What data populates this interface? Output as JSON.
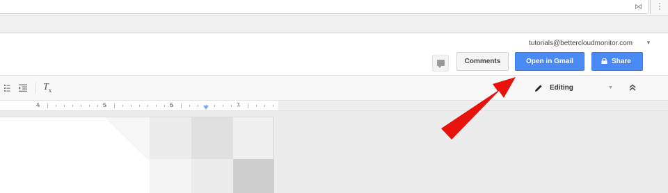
{
  "browser": {
    "extension_icon": "⋈",
    "menu_icon": "⋮"
  },
  "header": {
    "account_email": "tutorials@bettercloudmonitor.com",
    "account_caret": "▼",
    "comments_label": "Comments",
    "open_gmail_label": "Open in Gmail",
    "share_label": "Share"
  },
  "toolbar": {
    "clear_formatting_glyph": "T",
    "clear_formatting_sub": "x",
    "mode_label": "Editing",
    "mode_caret": "▼"
  },
  "ruler": {
    "numbers": [
      "4",
      "5",
      "6",
      "7"
    ]
  },
  "colors": {
    "accent_blue": "#4a8af4",
    "annotation_red": "#e8120c"
  },
  "icons": {
    "chat": "chat-icon",
    "lock": "lock-icon",
    "pencil": "pencil-icon",
    "collapse": "double-chevron-up-icon",
    "list": "bulleted-list-icon",
    "indent": "indent-icon"
  }
}
